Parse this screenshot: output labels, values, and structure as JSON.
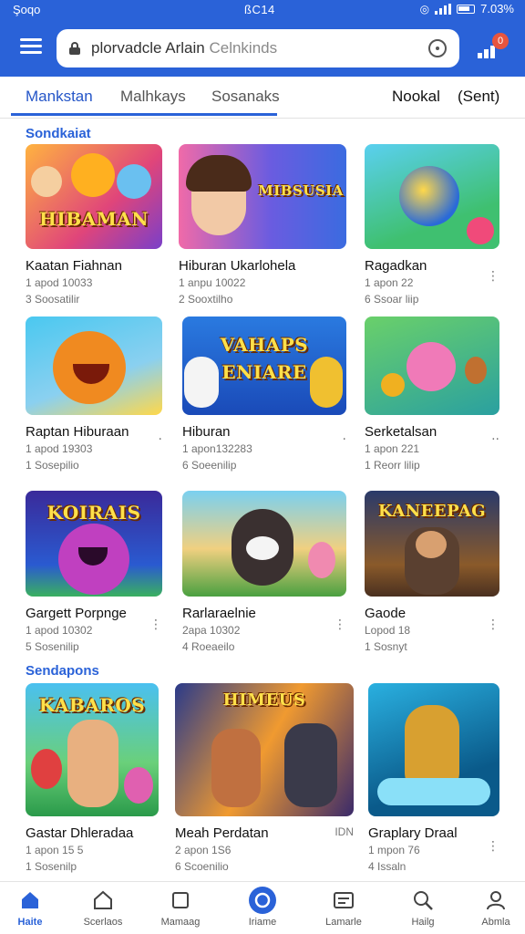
{
  "status": {
    "left": "Şoqo",
    "center": "ßC14",
    "right": "7.03%"
  },
  "search": {
    "value": "plorvadcle Arlain ",
    "placeholder": "Celnkinds"
  },
  "header": {
    "badge": "0"
  },
  "tabs": [
    {
      "label": "Mankstan"
    },
    {
      "label": "Malhkays"
    },
    {
      "label": "Sosanaks"
    },
    {
      "label": "Nookal"
    },
    {
      "label": "(Sent)"
    }
  ],
  "sections": [
    {
      "title": "Sondkaiat"
    },
    {
      "title": "Sendapons"
    }
  ],
  "cards": [
    {
      "title": "Kaatan Fiahnan",
      "meta1": "1 apod 10033",
      "meta2": "3 Soosatilir",
      "thumb_text": "HIBAMAN",
      "kebab": "⋮"
    },
    {
      "title": "Hiburan Ukarlohela",
      "meta1": "1 anpu 10022",
      "meta2": "2 Sooxtilho",
      "thumb_text": "MIBSUSIA",
      "kebab": ""
    },
    {
      "title": "Ragadkan",
      "meta1": "1 apon 22",
      "meta2": "6 Ssoar liip",
      "thumb_text": "",
      "kebab": "⋮"
    },
    {
      "title": "Raptan Hiburaan",
      "meta1": "1 apod 19303",
      "meta2": "1 Sosepilio",
      "thumb_text": "",
      "kebab": "⋅"
    },
    {
      "title": "Hiburan",
      "meta1": "1 apon132283",
      "meta2": "6 Soeenilip",
      "thumb_text": "VAHAPS ENIARE",
      "kebab": "⋅"
    },
    {
      "title": "Serketalsan",
      "meta1": "1 apon 221",
      "meta2": "1 Reorr lilip",
      "thumb_text": "",
      "kebab": "⋅⋅"
    },
    {
      "title": "Gargett Porpnge",
      "meta1": "1 apod 10302",
      "meta2": "5 Sosenilip",
      "thumb_text": "KOIRAIS",
      "kebab": "⋮"
    },
    {
      "title": "Rarlaraelnie",
      "meta1": "2apa 10302",
      "meta2": "4 Roeaeilo",
      "thumb_text": "",
      "kebab": "⋮"
    },
    {
      "title": "Gaode",
      "meta1": "Lopod 18",
      "meta2": "1 Sosnyt",
      "thumb_text": "KANEEPAG",
      "kebab": "⋮"
    },
    {
      "title": "Gastar Dhleradaa",
      "meta1": "1 apon 15 5",
      "meta2": "1 Sosenilp",
      "thumb_text": "KABAROS",
      "kebab": ""
    },
    {
      "title": "Meah Perdatan",
      "meta1": "2 apon 1S6",
      "meta2": "6 Scoenilio",
      "thumb_text": "HIMEUS",
      "kebab": "IDN"
    },
    {
      "title": "Graplary Draal",
      "meta1": "1 mpon 76",
      "meta2": "4 Issaln",
      "thumb_text": "",
      "kebab": "⋮"
    }
  ],
  "bottom_nav": [
    {
      "label": "Haite",
      "icon": "home-icon"
    },
    {
      "label": "Scerlaos",
      "icon": "house-outline-icon"
    },
    {
      "label": "Mamaag",
      "icon": "square-icon"
    },
    {
      "label": "Iriame",
      "icon": "refresh-circle-icon"
    },
    {
      "label": "Lamarle",
      "icon": "window-icon"
    },
    {
      "label": "Hailg",
      "icon": "search-icon"
    },
    {
      "label": "Abmla",
      "icon": "profile-icon"
    }
  ],
  "colors": {
    "accent": "#2a62d8",
    "badge": "#e8553e"
  }
}
